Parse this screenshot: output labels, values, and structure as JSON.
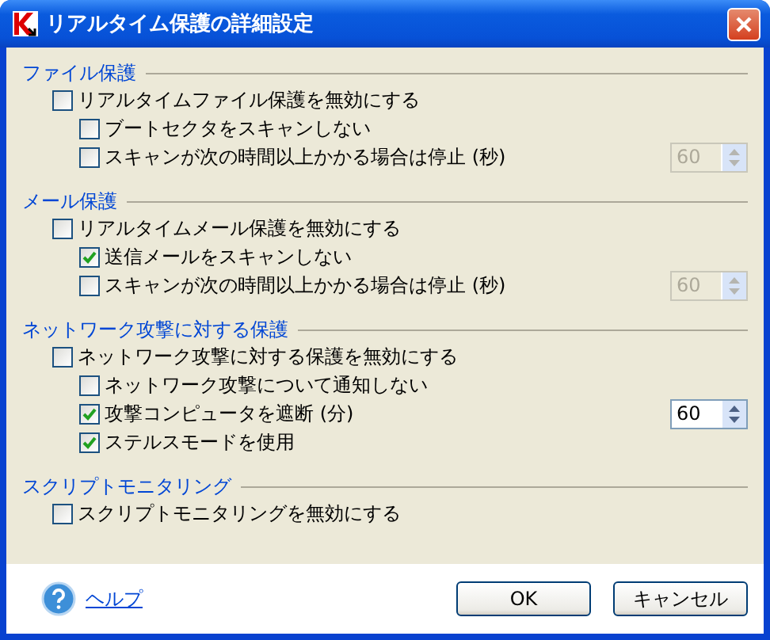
{
  "window": {
    "title": "リアルタイム保護の詳細設定"
  },
  "sections": [
    {
      "title": "ファイル保護",
      "options": [
        {
          "label": "リアルタイムファイル保護を無効にする",
          "checked": false,
          "children": [
            {
              "label": "ブートセクタをスキャンしない",
              "checked": false
            },
            {
              "label": "スキャンが次の時間以上かかる場合は停止 (秒)",
              "checked": false,
              "spinner": {
                "value": "60",
                "disabled": true
              }
            }
          ]
        }
      ]
    },
    {
      "title": "メール保護",
      "options": [
        {
          "label": "リアルタイムメール保護を無効にする",
          "checked": false,
          "children": [
            {
              "label": "送信メールをスキャンしない",
              "checked": true
            },
            {
              "label": "スキャンが次の時間以上かかる場合は停止 (秒)",
              "checked": false,
              "spinner": {
                "value": "60",
                "disabled": true
              }
            }
          ]
        }
      ]
    },
    {
      "title": "ネットワーク攻撃に対する保護",
      "options": [
        {
          "label": "ネットワーク攻撃に対する保護を無効にする",
          "checked": false,
          "children": [
            {
              "label": "ネットワーク攻撃について通知しない",
              "checked": false
            },
            {
              "label": "攻撃コンピュータを遮断 (分)",
              "checked": true,
              "spinner": {
                "value": "60",
                "disabled": false
              }
            },
            {
              "label": "ステルスモードを使用",
              "checked": true
            }
          ]
        }
      ]
    },
    {
      "title": "スクリプトモニタリング",
      "options": [
        {
          "label": "スクリプトモニタリングを無効にする",
          "checked": false
        }
      ]
    }
  ],
  "footer": {
    "help": "ヘルプ",
    "buttons": [
      "OK",
      "キャンセル"
    ]
  }
}
